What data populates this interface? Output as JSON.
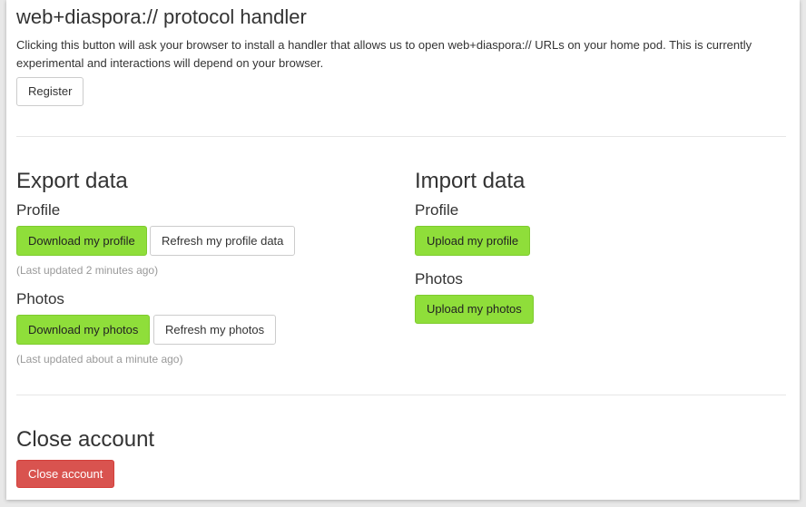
{
  "protocol": {
    "title": "web+diaspora:// protocol handler",
    "description": "Clicking this button will ask your browser to install a handler that allows us to open web+diaspora:// URLs on your home pod. This is currently experimental and interactions will depend on your browser.",
    "register_label": "Register"
  },
  "export": {
    "title": "Export data",
    "profile_heading": "Profile",
    "download_profile_label": "Download my profile",
    "refresh_profile_label": "Refresh my profile data",
    "profile_updated": "(Last updated 2 minutes ago)",
    "photos_heading": "Photos",
    "download_photos_label": "Download my photos",
    "refresh_photos_label": "Refresh my photos",
    "photos_updated": "(Last updated about a minute ago)"
  },
  "import": {
    "title": "Import data",
    "profile_heading": "Profile",
    "upload_profile_label": "Upload my profile",
    "photos_heading": "Photos",
    "upload_photos_label": "Upload my photos"
  },
  "close": {
    "title": "Close account",
    "button_label": "Close account"
  },
  "colors": {
    "success_button": "#8fde3a",
    "danger_button": "#d9534f",
    "page_background": "#e8e8e8"
  }
}
